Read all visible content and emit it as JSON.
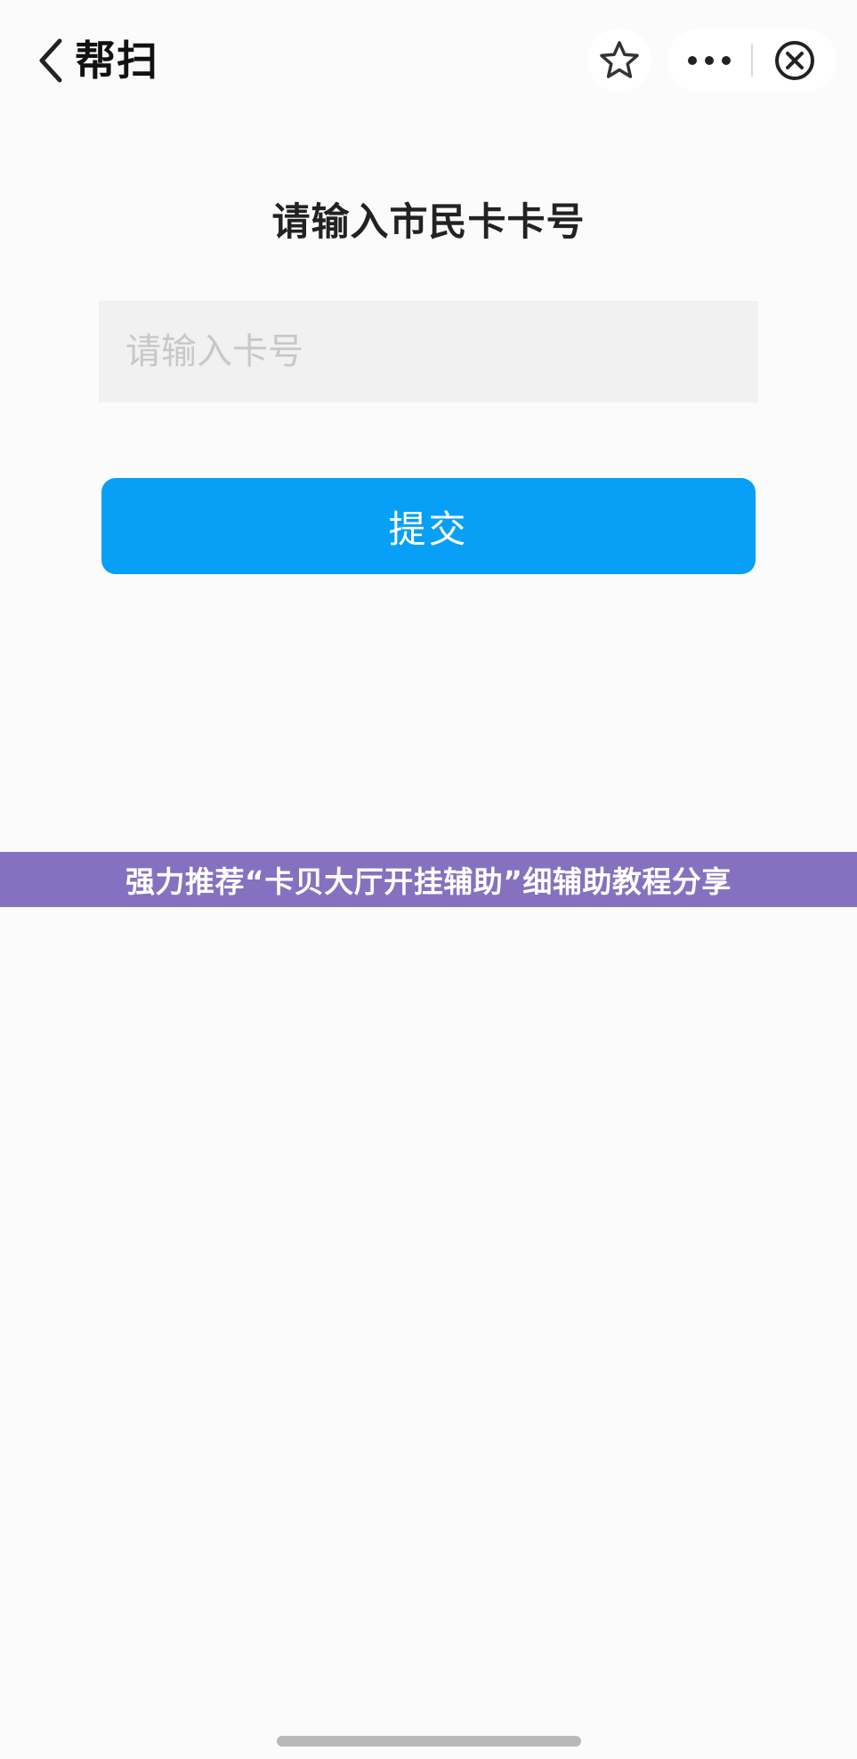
{
  "navbar": {
    "title": "帮扫",
    "back_icon": "chevron-left-icon",
    "favorite_icon": "star-icon",
    "more_icon": "more-dots-icon",
    "close_icon": "close-circle-icon"
  },
  "form": {
    "heading": "请输入市民卡卡号",
    "card_number": {
      "value": "",
      "placeholder": "请输入卡号"
    },
    "submit_label": "提交"
  },
  "banner": {
    "text": "强力推荐“卡贝大厅开挂辅助”细辅助教程分享"
  },
  "colors": {
    "accent": "#07a0f6",
    "banner": "#8671c0",
    "input_background": "#f1f1f2",
    "page_background": "#fbfbfc"
  }
}
